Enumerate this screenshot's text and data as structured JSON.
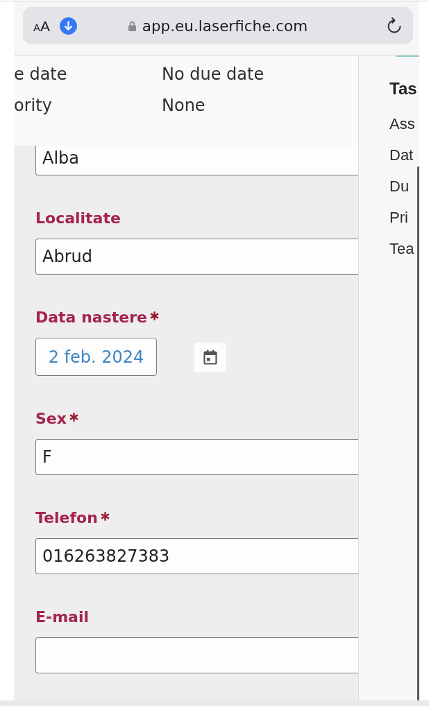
{
  "browser": {
    "text_size_button": "AA",
    "url": "app.eu.laserfiche.com"
  },
  "details": [
    {
      "label": "e date",
      "value": "No due date"
    },
    {
      "label": "ority",
      "value": "None"
    }
  ],
  "form": {
    "fields": [
      {
        "kind": "text",
        "value": "Alba"
      },
      {
        "kind": "text",
        "label": "Localitate",
        "required": false,
        "value": "Abrud"
      },
      {
        "kind": "date",
        "label": "Data nastere",
        "required": true,
        "value": "2 feb. 2024"
      },
      {
        "kind": "text",
        "label": "Sex",
        "required": true,
        "value": "F"
      },
      {
        "kind": "text",
        "label": "Telefon",
        "required": true,
        "value": "016263827383"
      },
      {
        "kind": "text",
        "label": "E-mail",
        "required": false
      }
    ]
  },
  "task_panel": {
    "title": "Tas",
    "rows": [
      "Ass",
      "Dat",
      "Du",
      "Pri",
      "Tea"
    ]
  }
}
